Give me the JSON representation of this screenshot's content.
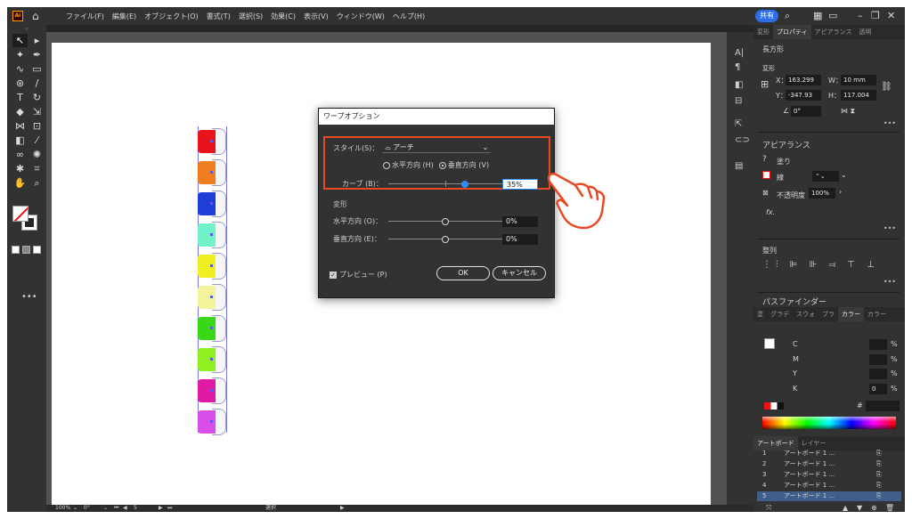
{
  "app": {
    "logo": "Ai"
  },
  "menu": [
    "ファイル(F)",
    "編集(E)",
    "オブジェクト(O)",
    "書式(T)",
    "選択(S)",
    "効果(C)",
    "表示(V)",
    "ウィンドウ(W)",
    "ヘルプ(H)"
  ],
  "menubar_right": {
    "share_label": "共有"
  },
  "swatch_colors": [
    "#e8131b",
    "#f07d20",
    "#1e3ed8",
    "#72f2c8",
    "#f0f020",
    "#f4f49a",
    "#38d818",
    "#8ef020",
    "#e01aa2",
    "#d94de8"
  ],
  "dialog": {
    "title": "ワープオプション",
    "style_label": "スタイル(S)：",
    "style_value": "アーチ",
    "horizontal_label": "水平方向 (H)",
    "vertical_label": "垂直方向 (V)",
    "bend_label": "カーブ (B)：",
    "bend_value": "35%",
    "bend_fraction": 0.675,
    "distortion_label": "変形",
    "dist_h_label": "水平方向 (O)：",
    "dist_h_value": "0%",
    "dist_v_label": "垂直方向 (E)：",
    "dist_v_value": "0%",
    "preview_label": "プレビュー (P)",
    "ok_label": "OK",
    "cancel_label": "キャンセル"
  },
  "panel": {
    "tabs": [
      "変形",
      "プロパティ",
      "アピアランス",
      "透明"
    ],
    "active_tab": "プロパティ",
    "object_type": "長方形",
    "transform_title": "変形",
    "x_label": "X：",
    "x_value": "163.299",
    "y_label": "Y：",
    "y_value": "-347.93",
    "w_label": "W：",
    "w_value": "10 mm",
    "h_label": "H：",
    "h_value": "117.004",
    "angle_value": "0°",
    "appearance_title": "アピアランス",
    "fill_label": "塗り",
    "stroke_label": "線",
    "opacity_label": "不透明度",
    "opacity_value": "100%",
    "fx_label": "fx.",
    "align_title": "整列",
    "pathfinder_title": "パスファインダー",
    "color_tabs": [
      "塗",
      "グラデ",
      "スウォ",
      "ブラ",
      "カラー",
      "カラー"
    ],
    "cmyk_labels": [
      "C",
      "M",
      "Y",
      "K"
    ],
    "k_value": "0",
    "pct_sign": "%",
    "hex_sign": "#",
    "layer_tabs": [
      "アートボード",
      "レイヤー"
    ],
    "artboards": [
      {
        "num": "1",
        "name": "アートボード 1 ..."
      },
      {
        "num": "2",
        "name": "アートボード 1 ..."
      },
      {
        "num": "3",
        "name": "アートボード 1 ..."
      },
      {
        "num": "4",
        "name": "アートボード 1 ..."
      },
      {
        "num": "5",
        "name": "アートボード 1 ..."
      }
    ]
  },
  "status": {
    "zoom": "100%",
    "rotation": "0°",
    "artboard_num": "5",
    "tool": "選択"
  }
}
